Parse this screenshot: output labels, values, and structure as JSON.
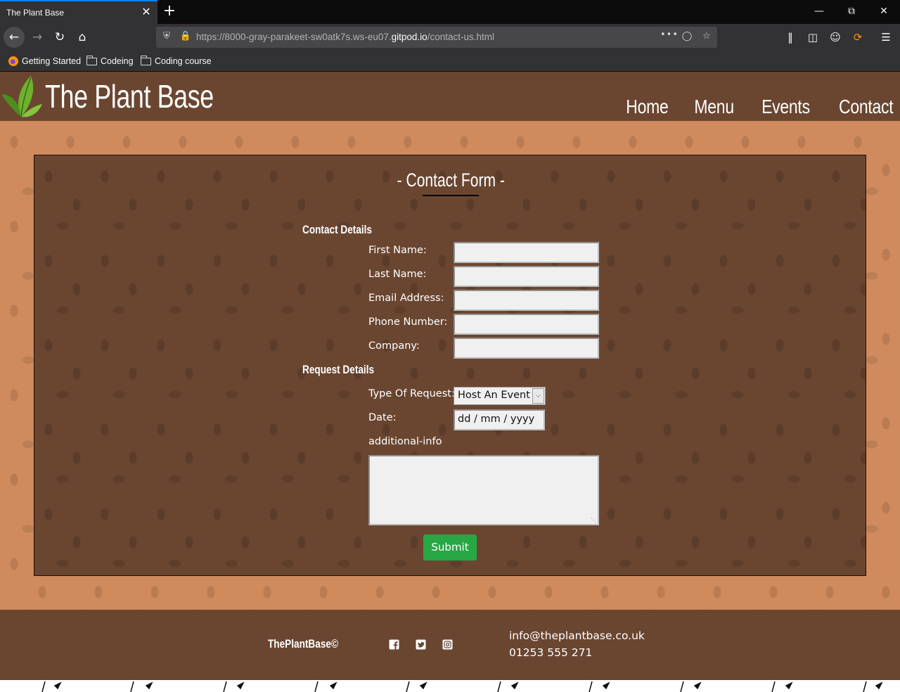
{
  "browser": {
    "tab_title": "The Plant Base",
    "url_prefix": "https://8000-gray-parakeet-sw0atk7s.ws-eu07.",
    "url_host": "gitpod.io",
    "url_path": "/contact-us.html",
    "bookmarks": [
      "Getting Started",
      "Codeing",
      "Coding course"
    ]
  },
  "site": {
    "brand": "The Plant Base",
    "nav": [
      "Home",
      "Menu",
      "Events",
      "Contact"
    ]
  },
  "form": {
    "title": "- Contact Form -",
    "contact_section": "Contact Details",
    "first_name_label": "First Name:",
    "last_name_label": "Last Name:",
    "email_label": "Email Address:",
    "phone_label": "Phone Number:",
    "company_label": "Company:",
    "request_section": "Request Details",
    "request_type_label": "Type Of Request:",
    "request_type_value": "Host An Event",
    "date_label": "Date:",
    "date_placeholder": "dd / mm / yyyy",
    "additional_label": "additional-info",
    "submit_label": "Submit"
  },
  "footer": {
    "copyright": "ThePlantBase©",
    "email": "info@theplantbase.co.uk",
    "phone": "01253 555 271"
  },
  "colors": {
    "header_brown": "#6a4631",
    "page_tan": "#cf8b5e",
    "submit_green": "#28a745"
  }
}
